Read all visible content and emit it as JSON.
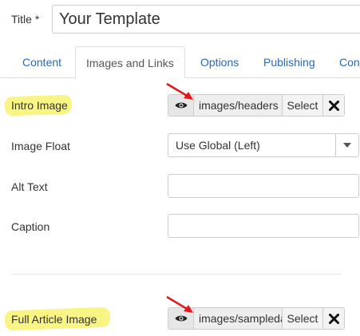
{
  "title_field": {
    "label": "Title *",
    "value": "Your Template"
  },
  "tabs": [
    {
      "label": "Content",
      "active": false
    },
    {
      "label": "Images and Links",
      "active": true
    },
    {
      "label": "Options",
      "active": false
    },
    {
      "label": "Publishing",
      "active": false
    },
    {
      "label": "Con",
      "active": false
    }
  ],
  "intro_image": {
    "label": "Intro Image",
    "path": "images/headers",
    "select_label": "Select",
    "preview_icon": "eye-icon",
    "clear_icon": "close-icon"
  },
  "image_float": {
    "label": "Image Float",
    "value": "Use Global (Left)",
    "caret_icon": "caret-down-icon"
  },
  "alt_text": {
    "label": "Alt Text",
    "value": ""
  },
  "caption": {
    "label": "Caption",
    "value": ""
  },
  "full_article_image": {
    "label": "Full Article Image",
    "path": "images/sampledata",
    "select_label": "Select",
    "preview_icon": "eye-icon",
    "clear_icon": "close-icon"
  },
  "colors": {
    "tab_link": "#2a69b8",
    "highlight": "#f5f25c",
    "annotation_arrow": "#e3161c",
    "border": "#cccccc"
  }
}
